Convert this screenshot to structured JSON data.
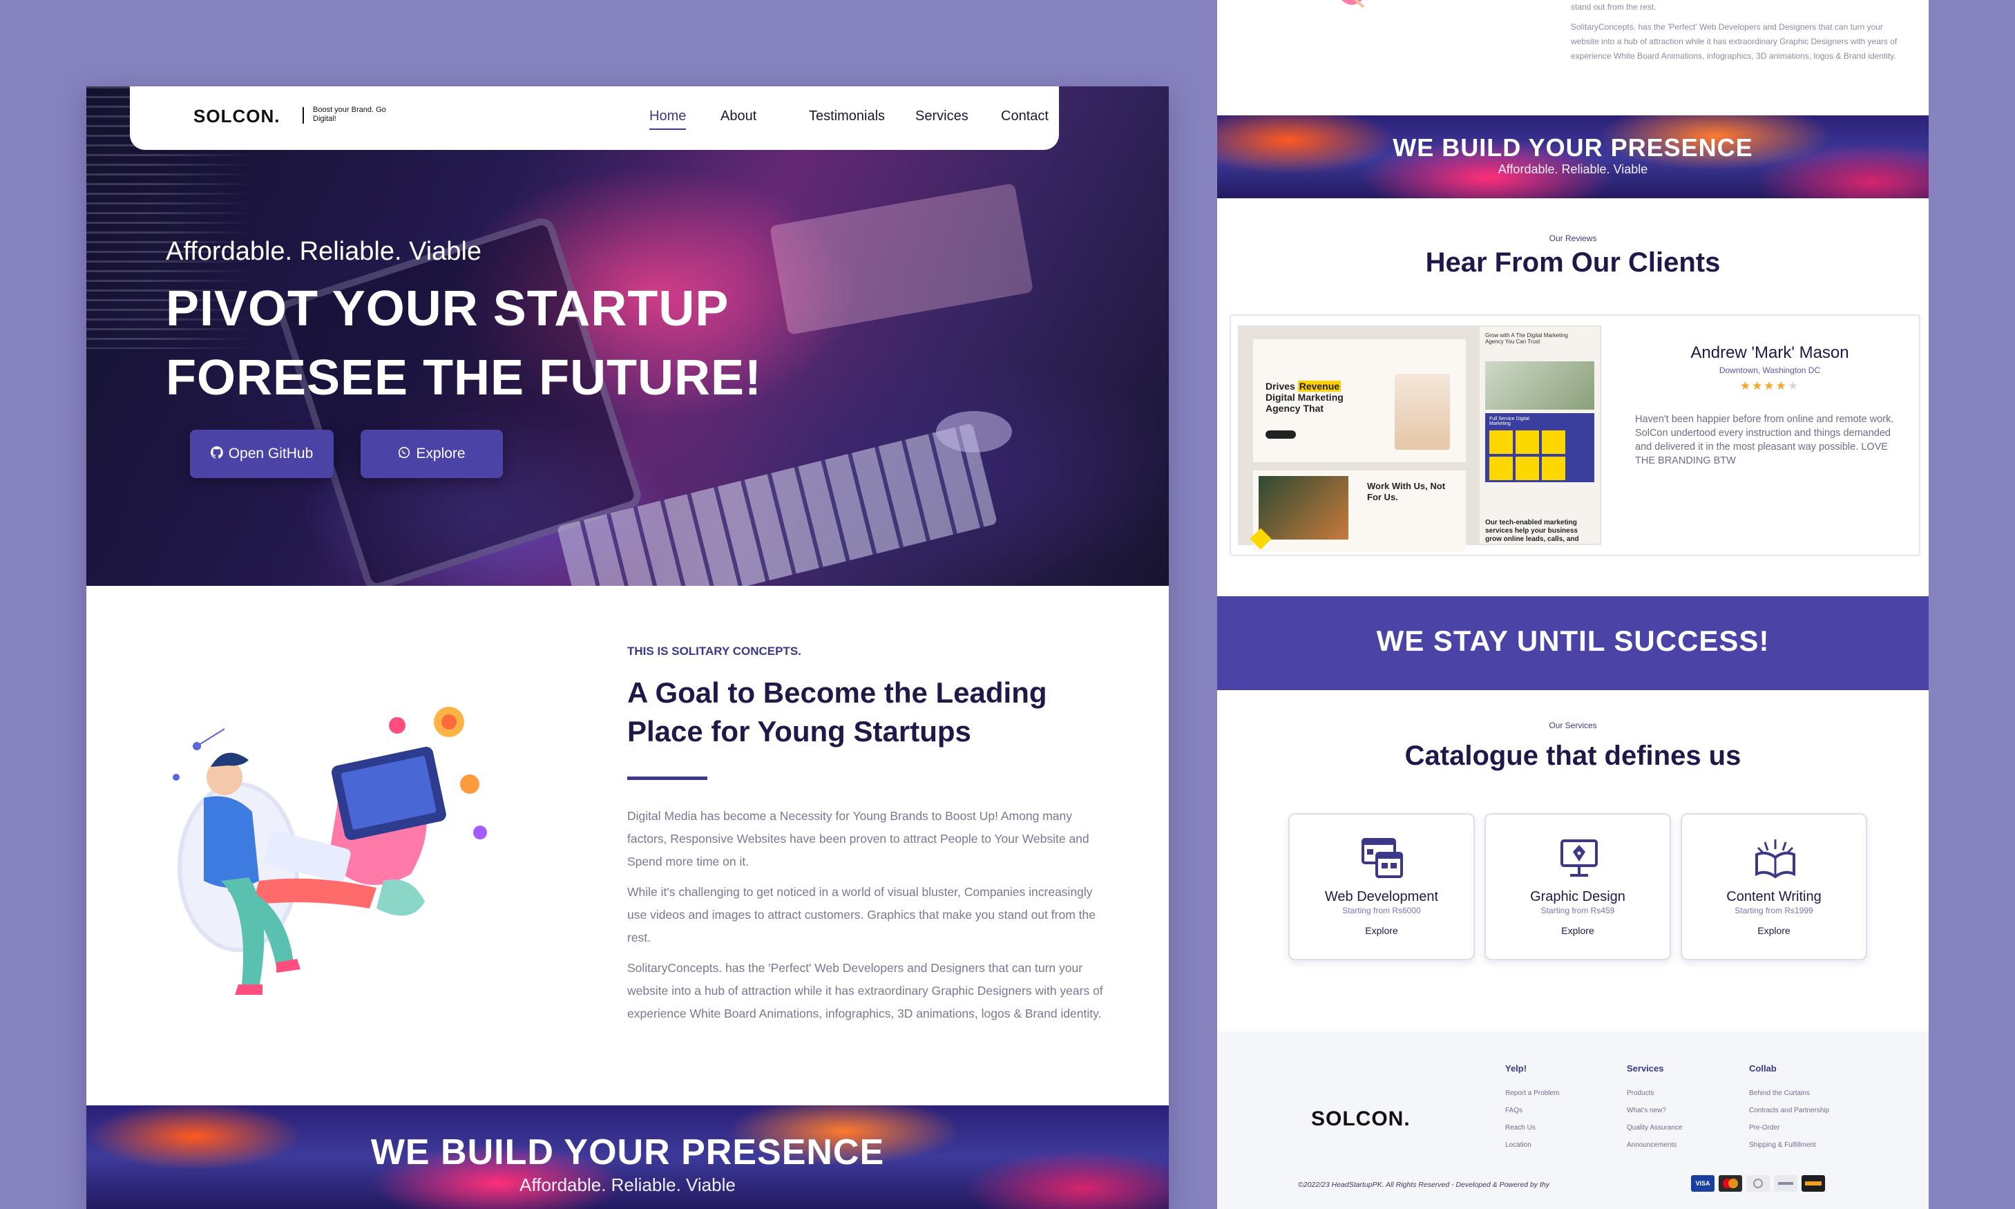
{
  "colors": {
    "page_bg": "#8683bf",
    "accent": "#4b44a6",
    "heading": "#1d1a4a",
    "star": "#f5a623"
  },
  "header": {
    "logo": "SOLCON.",
    "tagline": "Boost your Brand. Go Digital!",
    "nav": [
      "Home",
      "About",
      "Testimonials",
      "Services",
      "Contact"
    ],
    "active_nav": "Home"
  },
  "hero": {
    "subtitle": "Affordable. Reliable. Viable",
    "title_line1": "PIVOT YOUR STARTUP",
    "title_line2": "FORESEE THE FUTURE!",
    "btn_github": "Open GitHub",
    "btn_github_icon": "github-icon",
    "btn_explore": "Explore",
    "btn_explore_icon": "whatsapp-icon"
  },
  "about": {
    "eyebrow": "THIS IS SOLITARY CONCEPTS.",
    "title": "A Goal to Become the Leading Place for Young Startups",
    "paragraphs": [
      "Digital Media has become a Necessity for Young Brands to Boost Up! Among many factors, Responsive Websites have been proven to attract People to Your Website and Spend more time on it.",
      "While it's challenging to get noticed in a world of visual bluster, Companies increasingly use videos and images to attract customers. Graphics that make you stand out from the rest.",
      "SolitaryConcepts. has the 'Perfect' Web Developers and Designers that can turn your website into a hub of attraction while it has extraordinary Graphic Designers with years of experience White Board Animations, infographics, 3D animations, logos & Brand identity."
    ]
  },
  "banner": {
    "title": "WE BUILD YOUR PRESENCE",
    "subtitle": "Affordable. Reliable. Viable"
  },
  "right_top": {
    "line0": "stand out from the rest.",
    "para": "SolitaryConcepts. has the 'Perfect' Web Developers and Designers that can turn your website into a hub of attraction while it has extraordinary Graphic Designers with years of experience White Board Animations, infographics, 3D animations, logos & Brand identity."
  },
  "reviews": {
    "eyebrow": "Our Reviews",
    "title": "Hear From Our Clients",
    "mockup": {
      "headline_a": "Drives ",
      "headline_hl": "Revenue",
      "headline_b": " Digital Marketing Agency That",
      "work": "Work With Us, Not For Us.",
      "side": "Grow with A The Digital Marketing Agency You Can Trust",
      "tech": "Our tech-enabled marketing services help your business grow online leads, calls, and",
      "full": "Full Service Digital Marketing"
    },
    "name": "Andrew 'Mark' Mason",
    "location": "Downtown, Washington DC",
    "rating": 4,
    "rating_max": 5,
    "text": "Haven't been happier before from online and remote work. SolCon undertood every instruction and things demanded and delivered it in the most pleasant way possible. LOVE THE BRANDING BTW"
  },
  "stay": {
    "title": "WE STAY UNTIL SUCCESS!"
  },
  "services": {
    "eyebrow": "Our Services",
    "title": "Catalogue that defines us",
    "items": [
      {
        "name": "Web Development",
        "price": "Starting from Rs6000",
        "cta": "Explore",
        "icon": "web-development-icon"
      },
      {
        "name": "Graphic Design",
        "price": "Starting from Rs459",
        "cta": "Explore",
        "icon": "graphic-design-icon"
      },
      {
        "name": "Content Writing",
        "price": "Starting from Rs1999",
        "cta": "Explore",
        "icon": "content-writing-icon"
      }
    ]
  },
  "footer": {
    "logo": "SOLCON.",
    "columns": [
      {
        "heading": "Yelp!",
        "links": [
          "Report a Problem",
          "FAQs",
          "Reach Us",
          "Location"
        ]
      },
      {
        "heading": "Services",
        "links": [
          "Products",
          "What's new?",
          "Quality Assurance",
          "Announcements"
        ]
      },
      {
        "heading": "Collab",
        "links": [
          "Behind the Curtains",
          "Contracts and Partnership",
          "Pre-Order",
          "Shipping & Fulfillment"
        ]
      }
    ],
    "copyright": "©2022/23  HeadStartupPK. All Rights Reserved - Developed & Powered by thy",
    "payments": [
      "visa-icon",
      "mastercard-icon",
      "diners-icon",
      "amex-icon",
      "card-icon"
    ]
  }
}
